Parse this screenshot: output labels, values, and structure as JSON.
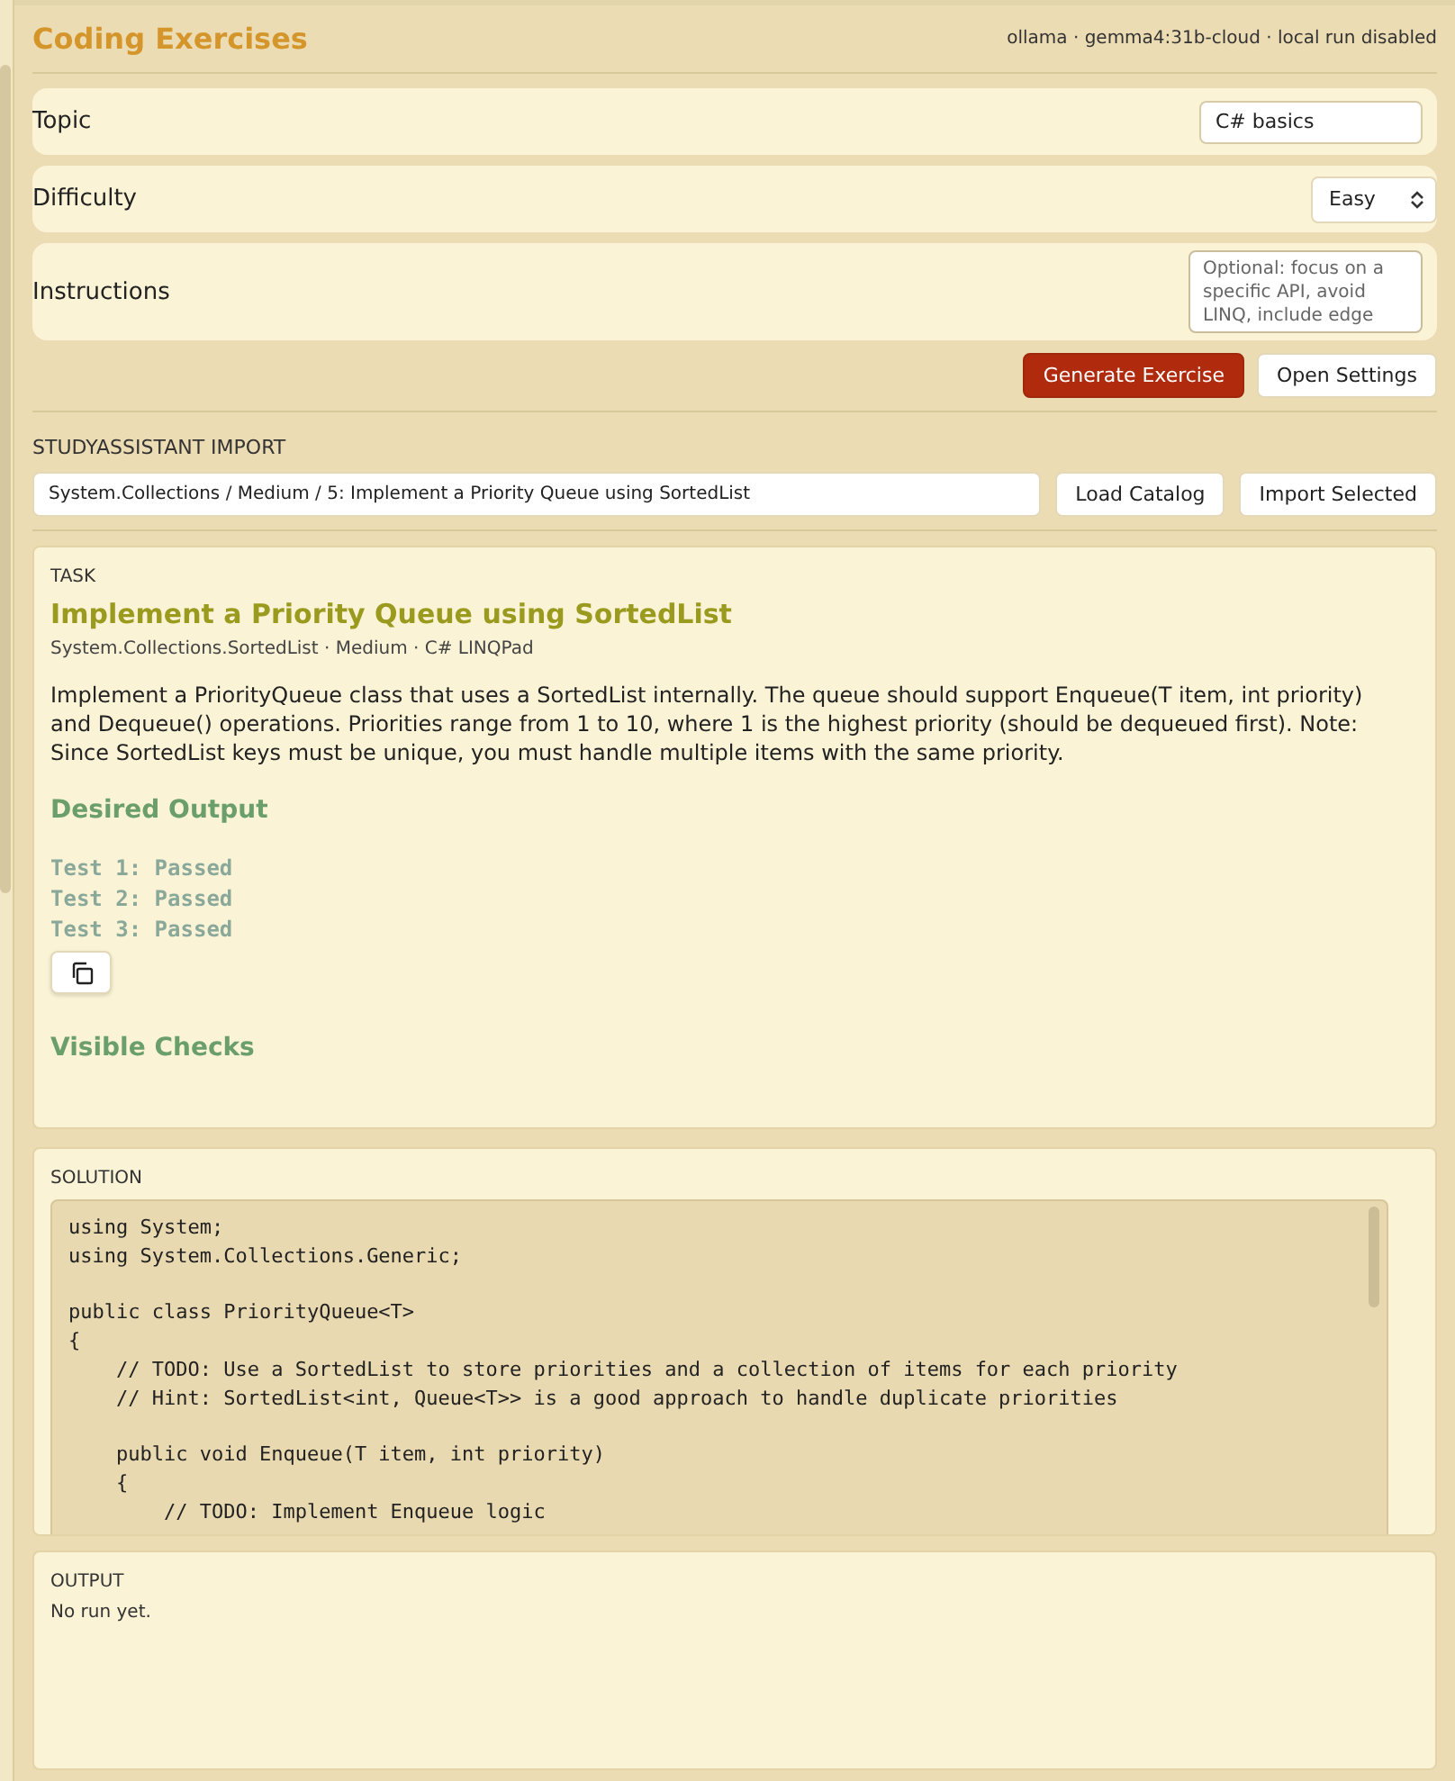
{
  "header": {
    "title": "Coding Exercises",
    "status": "ollama · gemma4:31b-cloud · local run disabled"
  },
  "form": {
    "fields": [
      {
        "kind": "text",
        "label": "Topic",
        "value": "C# basics"
      },
      {
        "kind": "select",
        "label": "Difficulty",
        "value": "Easy"
      },
      {
        "kind": "textarea",
        "label": "Instructions",
        "placeholder": "Optional: focus on a specific API, avoid LINQ, include edge"
      }
    ],
    "buttons": [
      {
        "label": "Generate Exercise",
        "kind": "primary"
      },
      {
        "label": "Open Settings",
        "kind": "secondary"
      }
    ]
  },
  "import": {
    "heading": "STUDYASSISTANT IMPORT",
    "value": "System.Collections / Medium / 5: Implement a Priority Queue using SortedList",
    "buttons": [
      "Load Catalog",
      "Import Selected"
    ]
  },
  "task": {
    "heading": "TASK",
    "title": "Implement a Priority Queue using SortedList",
    "meta": "System.Collections.SortedList · Medium · C# LINQPad",
    "description": "Implement a PriorityQueue class that uses a SortedList internally. The queue should support Enqueue(T item, int priority) and Dequeue() operations. Priorities range from 1 to 10, where 1 is the highest priority (should be dequeued first). Note: Since SortedList keys must be unique, you must handle multiple items with the same priority.",
    "desired_output_heading": "Desired Output",
    "desired_output": [
      "Test 1: Passed",
      "Test 2: Passed",
      "Test 3: Passed"
    ],
    "visible_checks_heading": "Visible Checks"
  },
  "solution": {
    "heading": "SOLUTION",
    "code": "using System;\nusing System.Collections.Generic;\n\npublic class PriorityQueue<T>\n{\n    // TODO: Use a SortedList to store priorities and a collection of items for each priority\n    // Hint: SortedList<int, Queue<T>> is a good approach to handle duplicate priorities\n\n    public void Enqueue(T item, int priority)\n    {\n        // TODO: Implement Enqueue logic"
  },
  "output": {
    "heading": "OUTPUT",
    "text": "No run yet."
  }
}
